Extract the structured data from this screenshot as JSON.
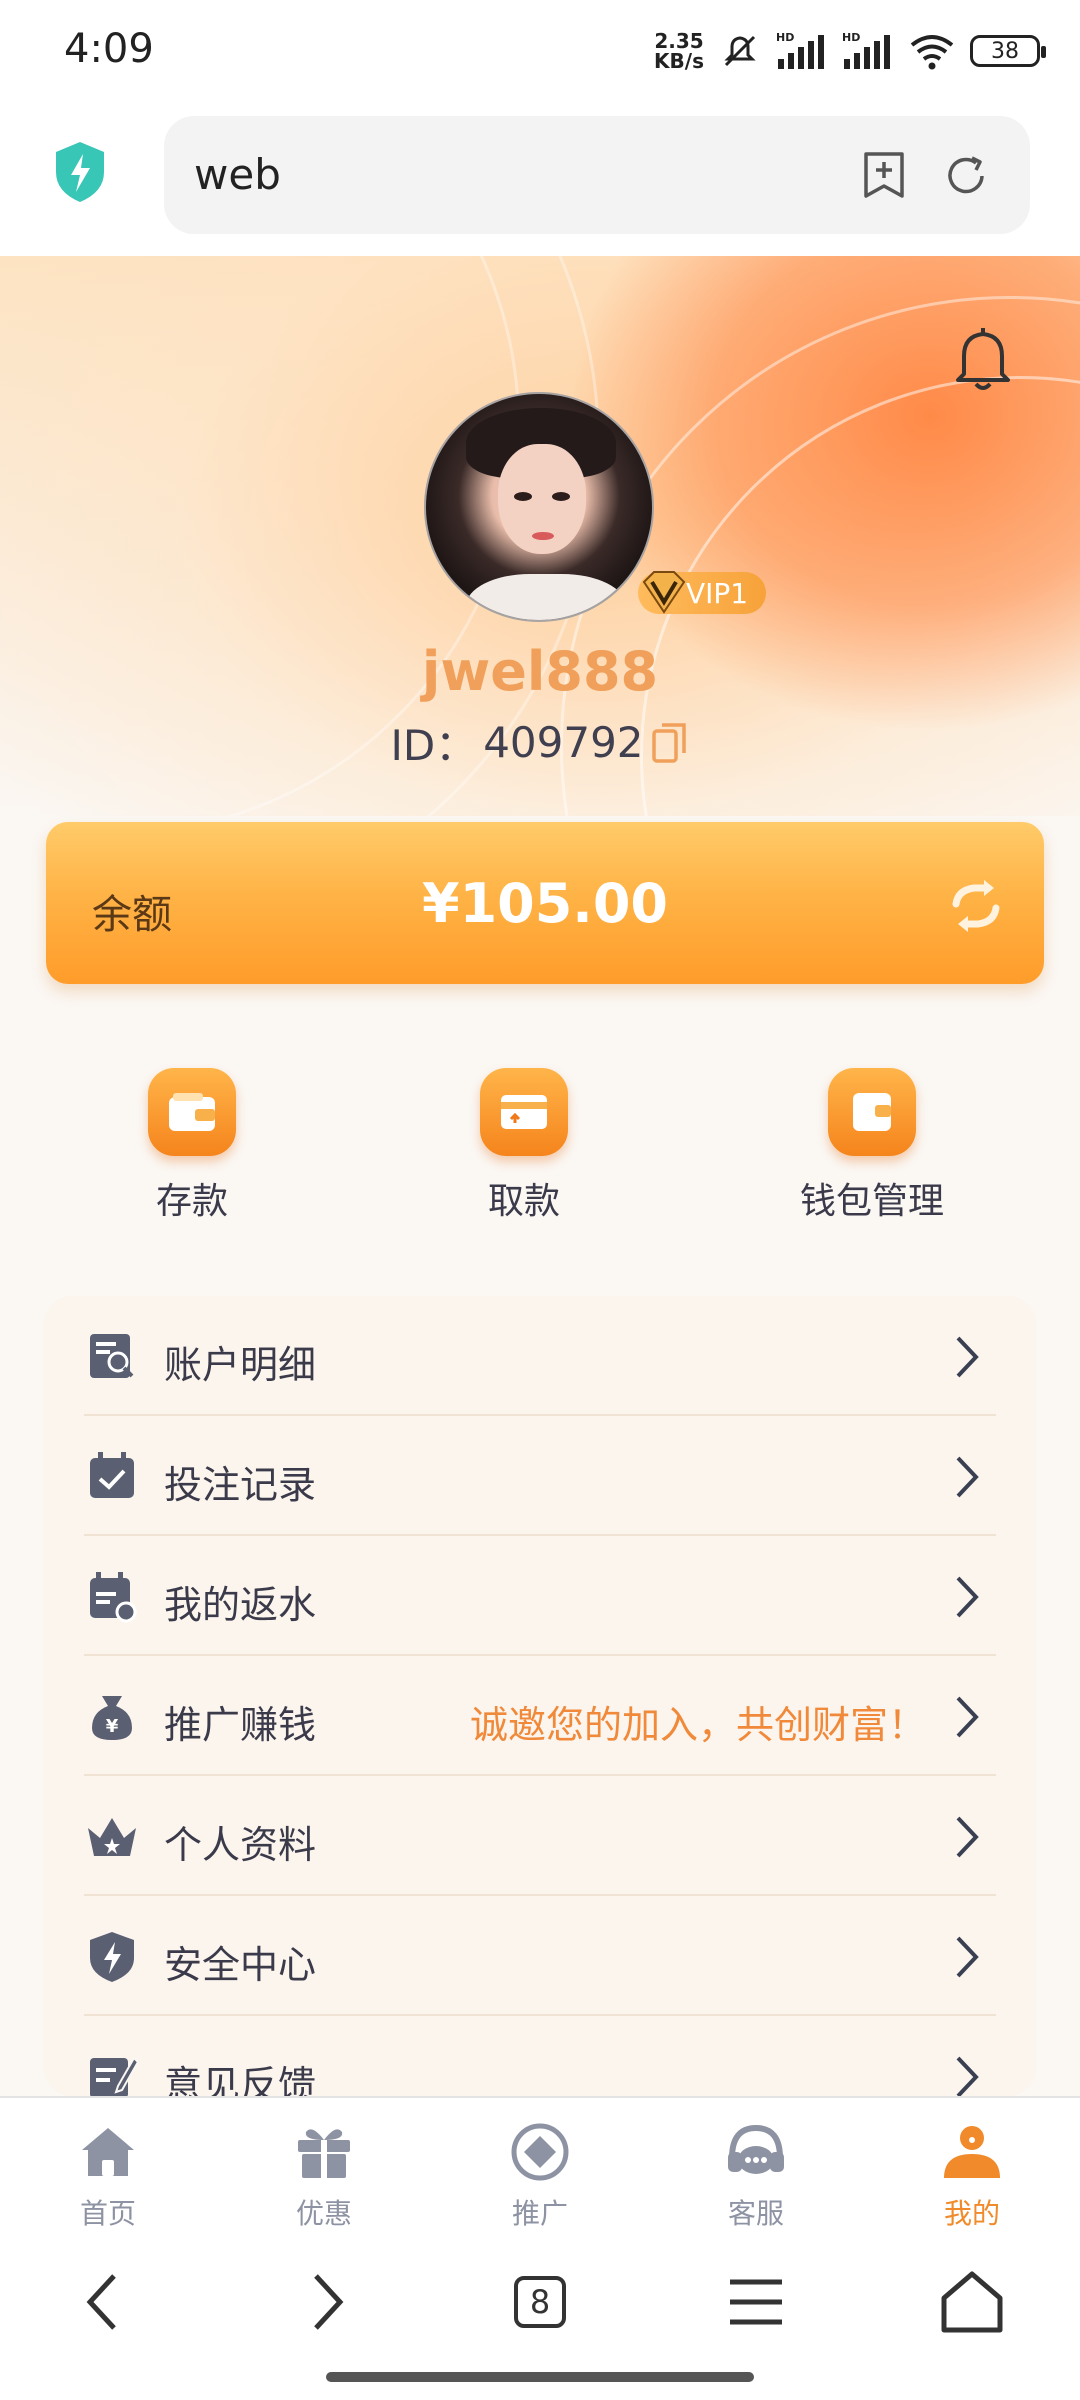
{
  "status_bar": {
    "time": "4:09",
    "net_speed_value": "2.35",
    "net_speed_unit": "KB/s",
    "battery": "38",
    "icons": [
      "mute-icon",
      "hd-signal-icon",
      "hd-signal-icon",
      "wifi-icon",
      "battery-icon"
    ]
  },
  "browser": {
    "url": "web",
    "icons": [
      "shield-icon",
      "bookmark-add-icon",
      "reload-icon"
    ]
  },
  "profile": {
    "username": "jwel888",
    "id_label": "ID：",
    "id_value": "409792",
    "vip": "VIP1"
  },
  "balance": {
    "label": "余额",
    "amount": "¥105.00"
  },
  "quick_actions": [
    {
      "label": "存款",
      "icon": "wallet-icon"
    },
    {
      "label": "取款",
      "icon": "withdraw-card-icon"
    },
    {
      "label": "钱包管理",
      "icon": "wallet-manage-icon"
    }
  ],
  "menu": [
    {
      "label": "账户明细",
      "icon": "account-detail-icon",
      "extra": ""
    },
    {
      "label": "投注记录",
      "icon": "bet-record-icon",
      "extra": ""
    },
    {
      "label": "我的返水",
      "icon": "rebate-icon",
      "extra": ""
    },
    {
      "label": "推广赚钱",
      "icon": "money-bag-icon",
      "extra": "诚邀您的加入，共创财富！"
    },
    {
      "label": "个人资料",
      "icon": "crown-icon",
      "extra": ""
    },
    {
      "label": "安全中心",
      "icon": "security-shield-icon",
      "extra": ""
    },
    {
      "label": "意见反馈",
      "icon": "feedback-icon",
      "extra": ""
    }
  ],
  "tabs": [
    {
      "label": "首页",
      "icon": "home-icon",
      "active": false
    },
    {
      "label": "优惠",
      "icon": "gift-icon",
      "active": false
    },
    {
      "label": "推广",
      "icon": "promote-icon",
      "active": false
    },
    {
      "label": "客服",
      "icon": "headset-icon",
      "active": false
    },
    {
      "label": "我的",
      "icon": "user-icon",
      "active": true
    }
  ],
  "browser_nav": {
    "tab_count": "8"
  },
  "colors": {
    "accent": "#f08a2a",
    "balance_gradient_top": "#ffcb6a",
    "balance_gradient_bottom": "#ff9c2a",
    "username": "#f0a05a"
  }
}
